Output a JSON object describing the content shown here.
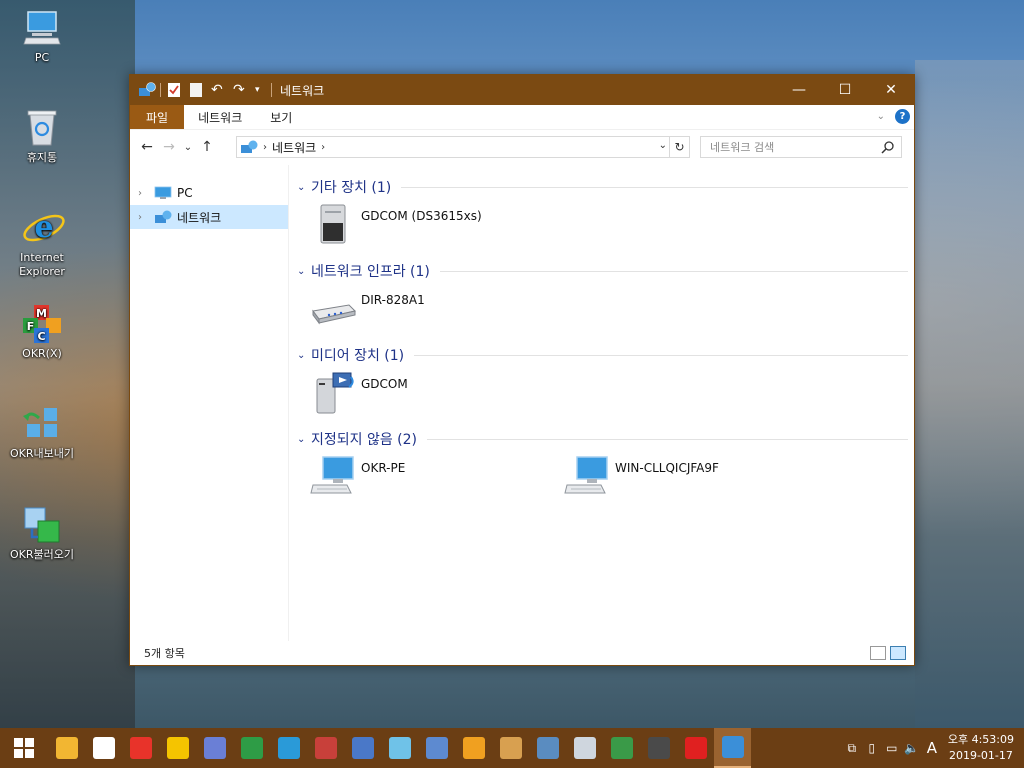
{
  "desktop": {
    "icons": [
      {
        "label": "PC",
        "icon": "pc-icon"
      },
      {
        "label": "휴지통",
        "icon": "recycle-bin-icon"
      },
      {
        "label": "Internet Explorer",
        "icon": "internet-explorer-icon"
      },
      {
        "label": "OKR(X)",
        "icon": "okr-icon"
      },
      {
        "label": "OKR내보내기",
        "icon": "okr-export-icon"
      },
      {
        "label": "OKR불러오기",
        "icon": "okr-import-icon"
      }
    ]
  },
  "window": {
    "title": "네트워크",
    "controls": {
      "minimize": "—",
      "maximize": "☐",
      "close": "✕"
    },
    "ribbon_tabs": [
      "파일",
      "네트워크",
      "보기"
    ],
    "nav": {
      "back": "←",
      "forward": "→",
      "recent": "⌄",
      "up": "↑"
    },
    "address": {
      "crumb": "네트워크",
      "arrow": "›"
    },
    "search": {
      "placeholder": "네트워크 검색"
    },
    "nav_pane": [
      {
        "label": "PC",
        "icon": "pc-icon"
      },
      {
        "label": "네트워크",
        "icon": "network-icon",
        "selected": true
      }
    ],
    "groups": [
      {
        "header": "기타 장치 (1)",
        "items": [
          {
            "name": "GDCOM (DS3615xs)",
            "icon": "nas-device-icon"
          }
        ]
      },
      {
        "header": "네트워크 인프라 (1)",
        "items": [
          {
            "name": "DIR-828A1",
            "icon": "router-icon"
          }
        ]
      },
      {
        "header": "미디어 장치 (1)",
        "items": [
          {
            "name": "GDCOM",
            "icon": "media-server-icon"
          }
        ]
      },
      {
        "header": "지정되지 않음 (2)",
        "items": [
          {
            "name": "OKR-PE",
            "icon": "computer-icon"
          },
          {
            "name": "WIN-CLLQICJFA9F",
            "icon": "computer-icon"
          }
        ]
      }
    ],
    "status": "5개 항목"
  },
  "taskbar": {
    "clock": {
      "time": "오후 4:53:09",
      "date": "2019-01-17"
    },
    "ime": "A",
    "apps": [
      {
        "icon": "file-explorer-icon",
        "color": "#f2b632"
      },
      {
        "icon": "capture-icon",
        "color": "#ffffff"
      },
      {
        "icon": "anydesk-icon",
        "color": "#e8332a"
      },
      {
        "icon": "potplayer-icon",
        "color": "#f5c400"
      },
      {
        "icon": "media-disc-icon",
        "color": "#6a7fd6"
      },
      {
        "icon": "chrome-icon",
        "color": "#2e9c46"
      },
      {
        "icon": "butterfly-icon",
        "color": "#2a9ad8"
      },
      {
        "icon": "paint-icon",
        "color": "#c8403a"
      },
      {
        "icon": "network-tool-icon",
        "color": "#4a78c8"
      },
      {
        "icon": "bottle-icon",
        "color": "#6fc2e8"
      },
      {
        "icon": "device-manager-icon",
        "color": "#5d8ad0"
      },
      {
        "icon": "power-icon",
        "color": "#f0a020"
      },
      {
        "icon": "disk-icon",
        "color": "#d8a050"
      },
      {
        "icon": "laptop-icon",
        "color": "#5a8cc0"
      },
      {
        "icon": "tools-icon",
        "color": "#cfd6de"
      },
      {
        "icon": "terminal-icon",
        "color": "#3a9a48"
      },
      {
        "icon": "photo-editor-icon",
        "color": "#4a4a4a"
      },
      {
        "icon": "red-x-icon",
        "color": "#e02020"
      },
      {
        "icon": "network-icon",
        "color": "#3b8fd8",
        "active": true
      }
    ]
  }
}
